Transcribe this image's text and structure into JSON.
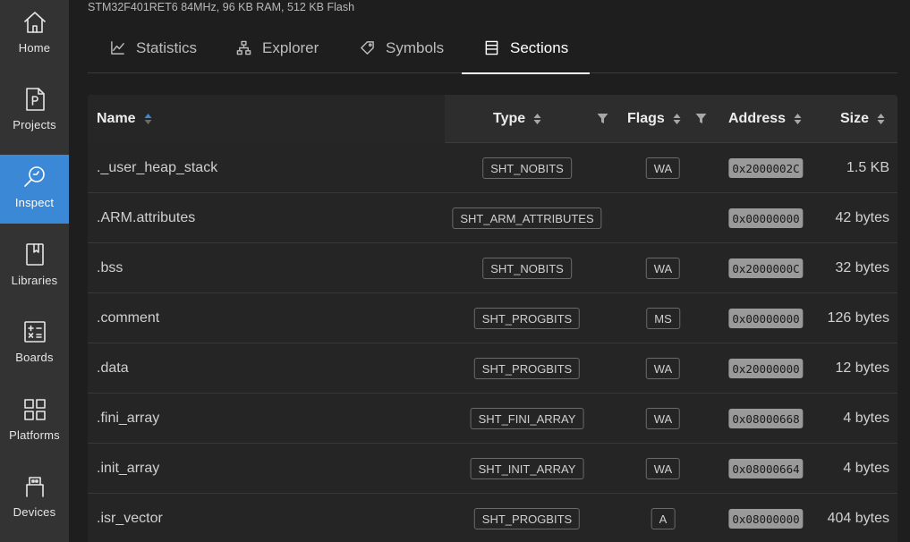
{
  "sidebar": {
    "items": [
      {
        "label": "Home",
        "icon": "home-icon",
        "active": false
      },
      {
        "label": "Projects",
        "icon": "project-file-icon",
        "active": false
      },
      {
        "label": "Inspect",
        "icon": "inspect-icon",
        "active": true
      },
      {
        "label": "Libraries",
        "icon": "book-icon",
        "active": false
      },
      {
        "label": "Boards",
        "icon": "calculator-icon",
        "active": false
      },
      {
        "label": "Platforms",
        "icon": "grid-icon",
        "active": false
      },
      {
        "label": "Devices",
        "icon": "usb-icon",
        "active": false
      }
    ],
    "active_color": "#3a88d6"
  },
  "device_info": "STM32F401RET6 84MHz, 96 KB RAM, 512 KB Flash",
  "tabs": [
    {
      "label": "Statistics",
      "icon": "line-chart-icon",
      "active": false
    },
    {
      "label": "Explorer",
      "icon": "sitemap-icon",
      "active": false
    },
    {
      "label": "Symbols",
      "icon": "tag-icon",
      "active": false
    },
    {
      "label": "Sections",
      "icon": "sections-icon",
      "active": true
    }
  ],
  "table": {
    "columns": {
      "name": "Name",
      "type": "Type",
      "flags": "Flags",
      "address": "Address",
      "size": "Size"
    },
    "rows": [
      {
        "name": "._user_heap_stack",
        "type": "SHT_NOBITS",
        "flags": "WA",
        "address": "0x2000002C",
        "size": "1.5 KB"
      },
      {
        "name": ".ARM.attributes",
        "type": "SHT_ARM_ATTRIBUTES",
        "flags": "",
        "address": "0x00000000",
        "size": "42 bytes"
      },
      {
        "name": ".bss",
        "type": "SHT_NOBITS",
        "flags": "WA",
        "address": "0x2000000C",
        "size": "32 bytes"
      },
      {
        "name": ".comment",
        "type": "SHT_PROGBITS",
        "flags": "MS",
        "address": "0x00000000",
        "size": "126 bytes"
      },
      {
        "name": ".data",
        "type": "SHT_PROGBITS",
        "flags": "WA",
        "address": "0x20000000",
        "size": "12 bytes"
      },
      {
        "name": ".fini_array",
        "type": "SHT_FINI_ARRAY",
        "flags": "WA",
        "address": "0x08000668",
        "size": "4 bytes"
      },
      {
        "name": ".init_array",
        "type": "SHT_INIT_ARRAY",
        "flags": "WA",
        "address": "0x08000664",
        "size": "4 bytes"
      },
      {
        "name": ".isr_vector",
        "type": "SHT_PROGBITS",
        "flags": "A",
        "address": "0x08000000",
        "size": "404 bytes"
      }
    ]
  }
}
